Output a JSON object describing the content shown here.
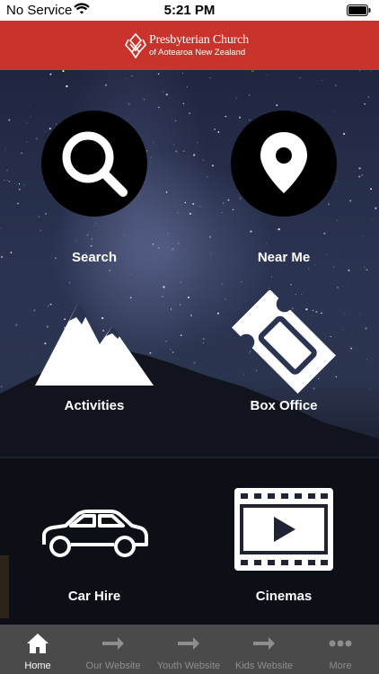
{
  "status_bar": {
    "carrier": "No Service",
    "time": "5:21 PM"
  },
  "header": {
    "logo_line1": "Presbyterian Church",
    "logo_line2": "of Aotearoa New Zealand",
    "background_color": "#c8332b"
  },
  "tiles": [
    {
      "label": "Search",
      "icon": "search-icon"
    },
    {
      "label": "Near Me",
      "icon": "map-pin-icon"
    },
    {
      "label": "Activities",
      "icon": "mountains-icon"
    },
    {
      "label": "Box Office",
      "icon": "ticket-icon"
    },
    {
      "label": "Car Hire",
      "icon": "car-icon"
    },
    {
      "label": "Cinemas",
      "icon": "film-play-icon"
    }
  ],
  "tabbar": {
    "items": [
      {
        "label": "Home",
        "icon": "home-icon",
        "active": true
      },
      {
        "label": "Our Website",
        "icon": "arrow-right-icon",
        "active": false
      },
      {
        "label": "Youth Website",
        "icon": "arrow-right-icon",
        "active": false
      },
      {
        "label": "Kids Website",
        "icon": "arrow-right-icon",
        "active": false
      },
      {
        "label": "More",
        "icon": "more-dots-icon",
        "active": false
      }
    ],
    "active_color": "#ffffff",
    "inactive_color": "#8e8e8e"
  }
}
